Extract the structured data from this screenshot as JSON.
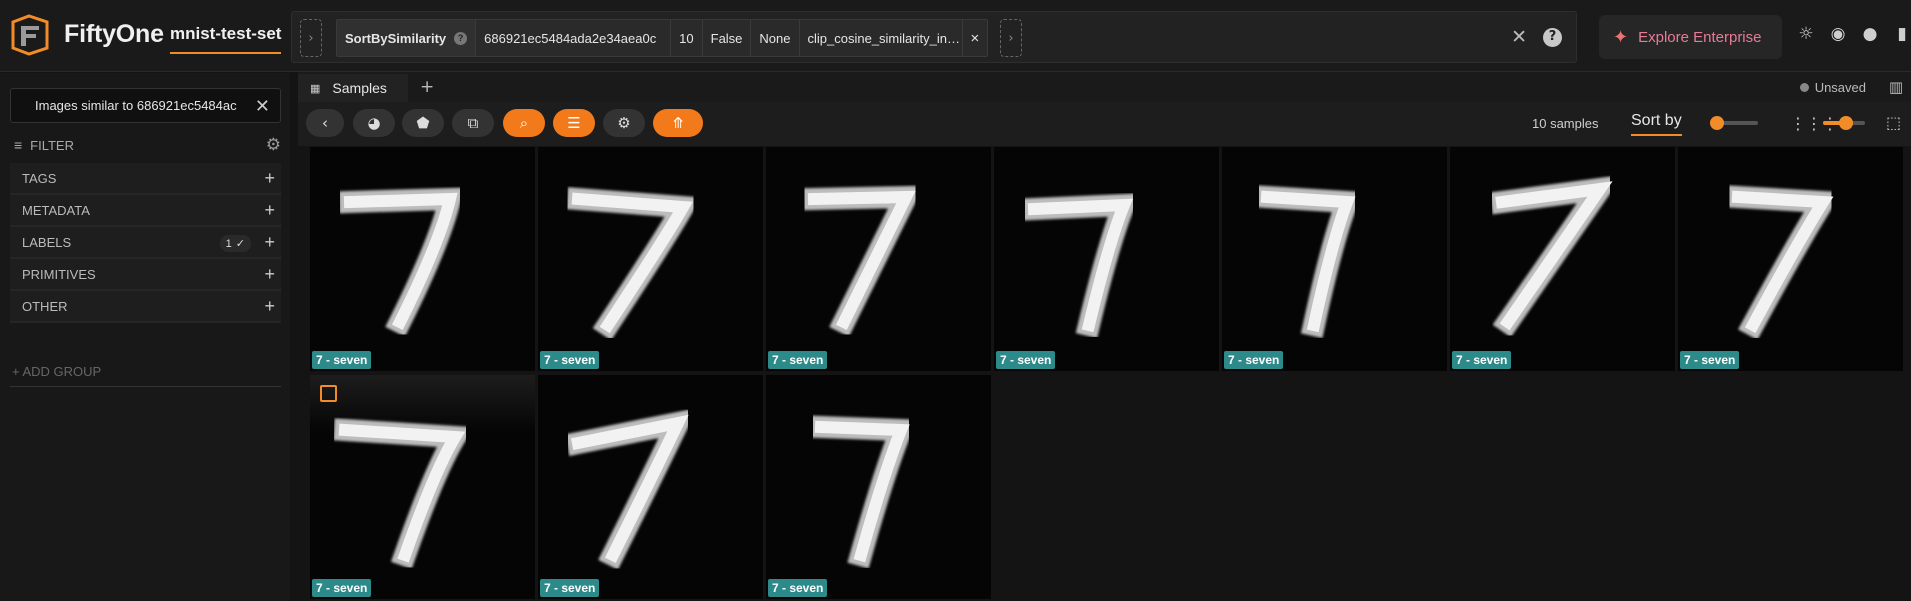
{
  "app": {
    "brand": "FiftyOne",
    "dataset": "mnist-test-set"
  },
  "view_stage": {
    "name": "SortBySimilarity",
    "params": [
      "686921ec5484ada2e34aea0c",
      "10",
      "False",
      "None",
      "clip_cosine_similarity_in…"
    ],
    "close": "×"
  },
  "topbar": {
    "clear_icon": "close-icon",
    "help_text": "?",
    "enterprise_label": "Explore Enterprise",
    "icons": [
      "theme-icon",
      "discord-icon",
      "github-icon",
      "docs-icon"
    ]
  },
  "sidebar": {
    "search_pill": "Images similar to 686921ec5484ac",
    "filter_label": "FILTER",
    "groups": [
      {
        "label": "TAGS"
      },
      {
        "label": "METADATA"
      },
      {
        "label": "LABELS",
        "badge": "1"
      },
      {
        "label": "PRIMITIVES"
      },
      {
        "label": "OTHER"
      }
    ],
    "add_group": "+ ADD GROUP"
  },
  "tabs": {
    "active": "Samples",
    "unsaved": "Unsaved"
  },
  "toolbar": {
    "count": "10 samples",
    "sort_by": "Sort by"
  },
  "samples": [
    {
      "label": "7 - seven"
    },
    {
      "label": "7 - seven"
    },
    {
      "label": "7 - seven"
    },
    {
      "label": "7 - seven"
    },
    {
      "label": "7 - seven"
    },
    {
      "label": "7 - seven"
    },
    {
      "label": "7 - seven"
    },
    {
      "label": "7 - seven"
    },
    {
      "label": "7 - seven"
    },
    {
      "label": "7 - seven"
    }
  ],
  "colors": {
    "accent": "#f28c28",
    "label_bg": "#2d8a8a",
    "enterprise": "#e87b96"
  }
}
